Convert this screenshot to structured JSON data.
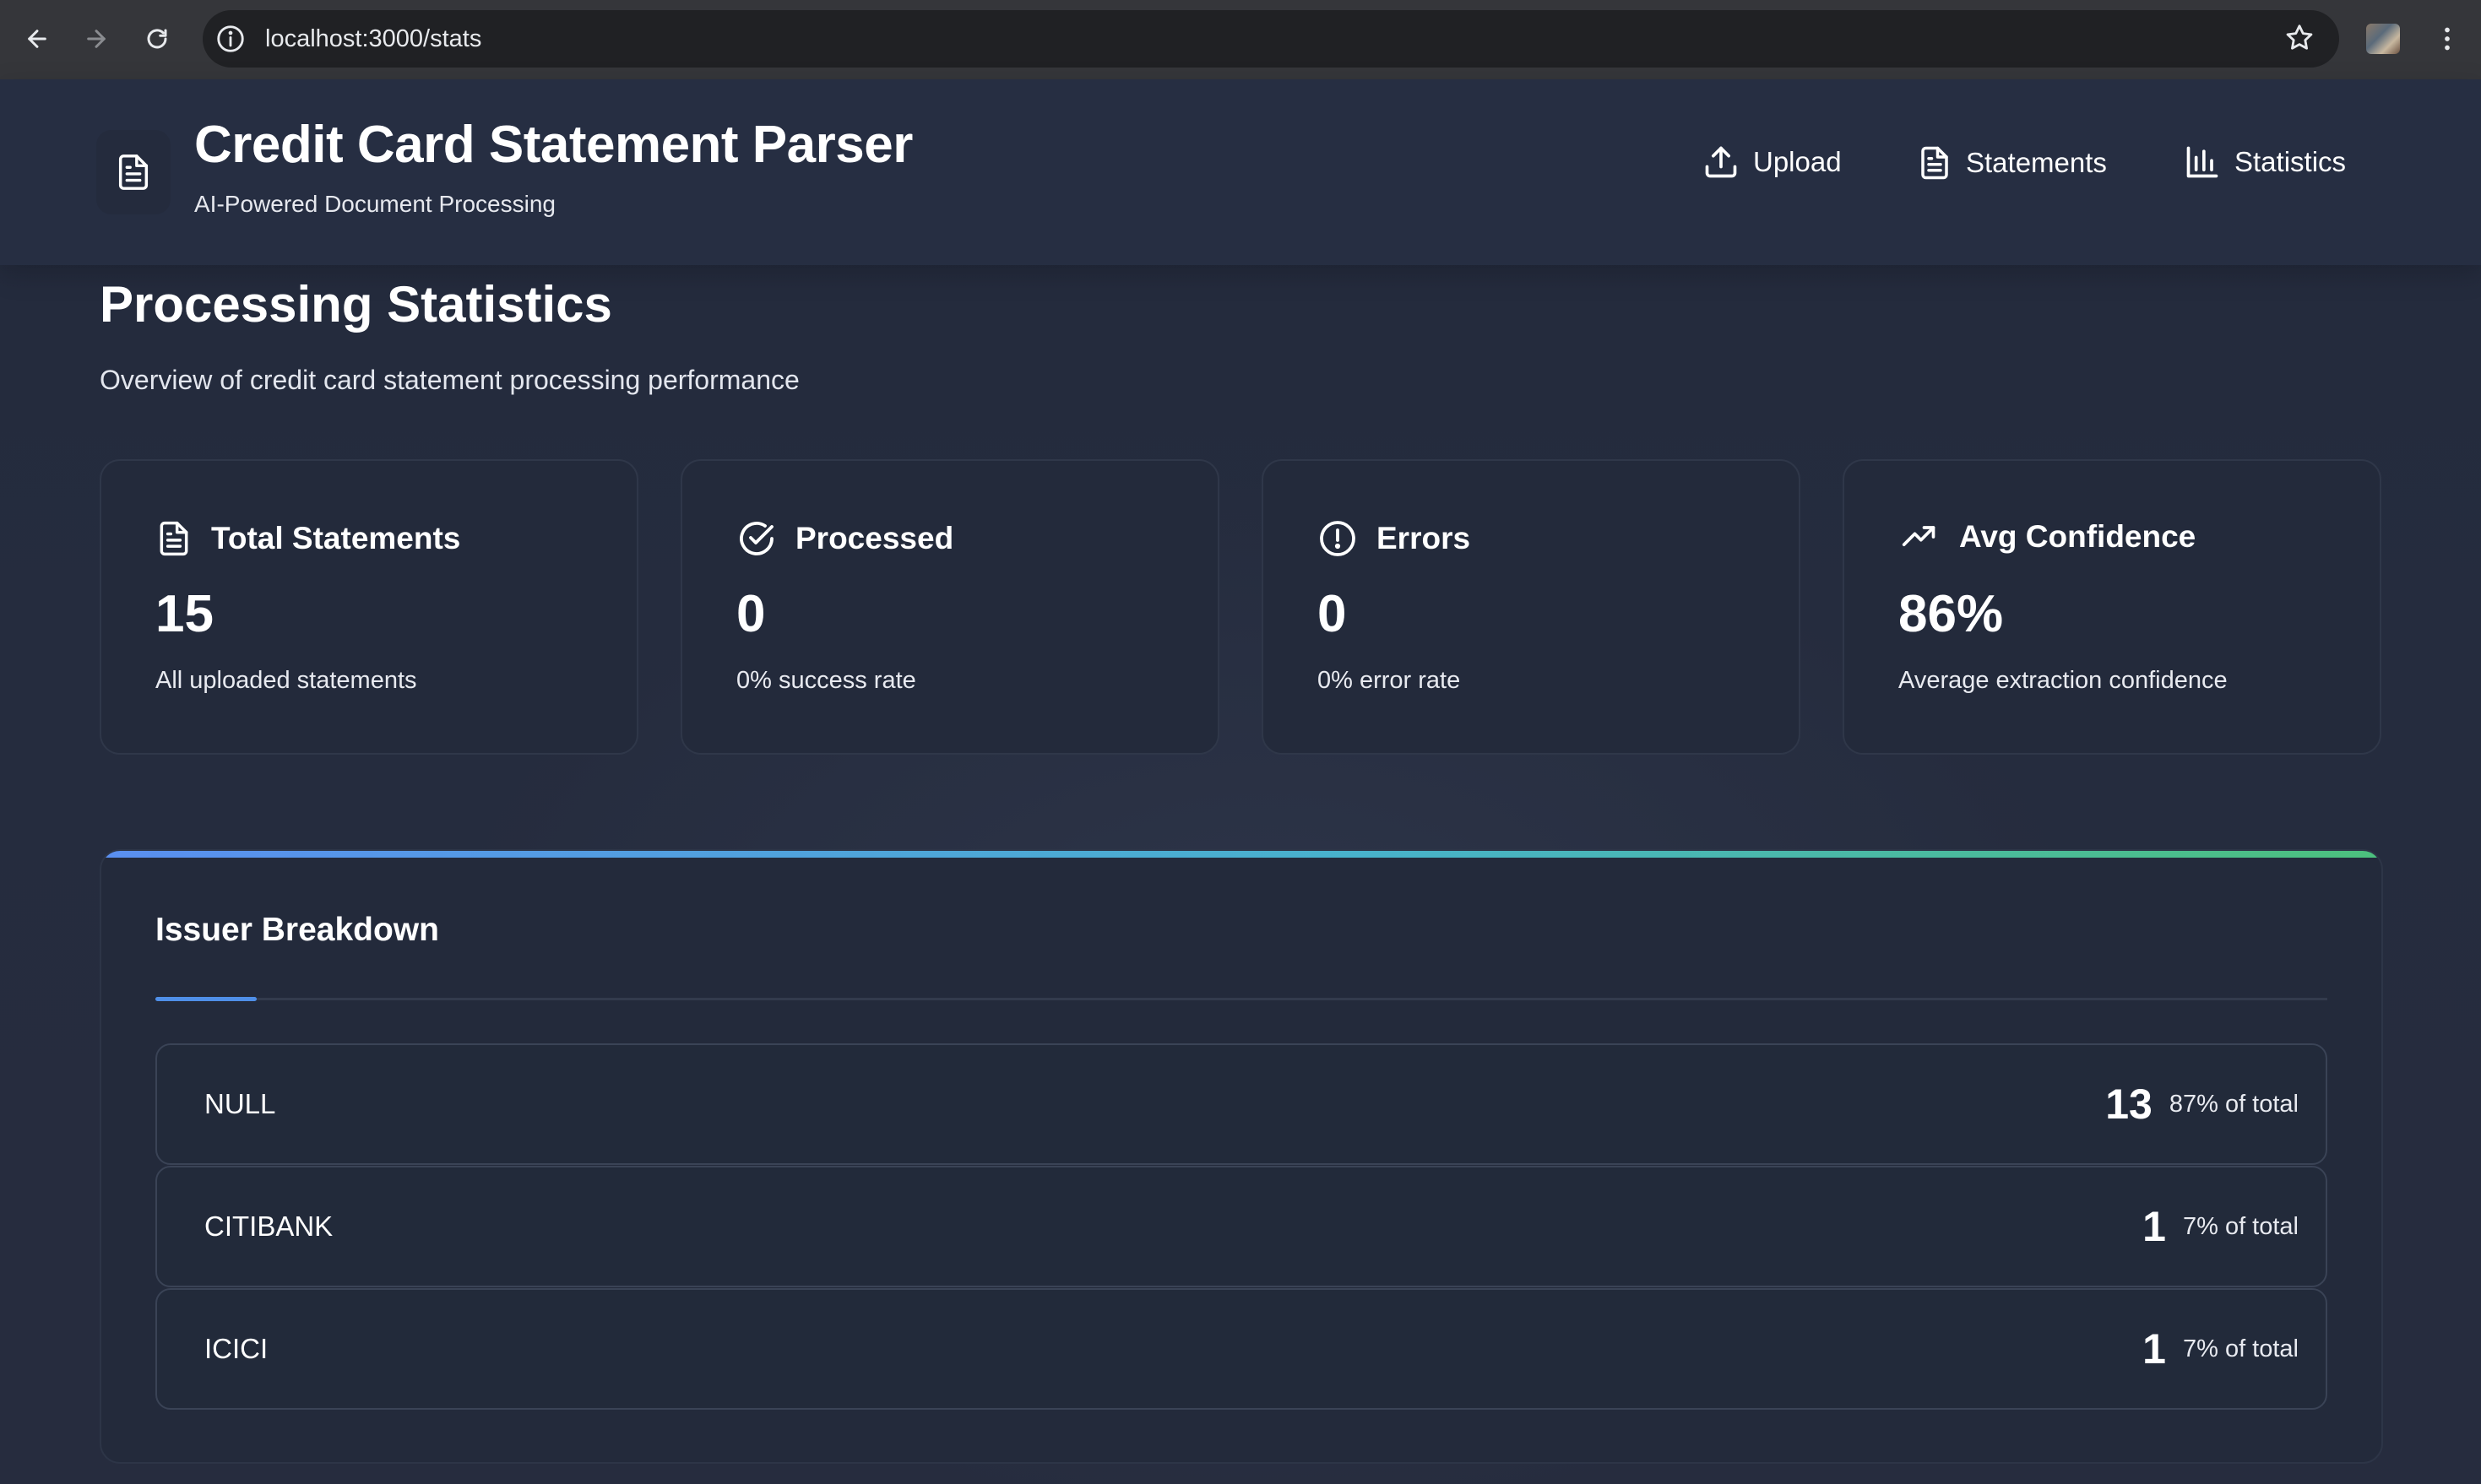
{
  "browser": {
    "url": "localhost:3000/stats"
  },
  "header": {
    "title": "Credit Card Statement Parser",
    "subtitle": "AI-Powered Document Processing",
    "nav": [
      {
        "label": "Upload",
        "icon": "upload-icon"
      },
      {
        "label": "Statements",
        "icon": "document-icon"
      },
      {
        "label": "Statistics",
        "icon": "bar-chart-icon"
      }
    ]
  },
  "main": {
    "title": "Processing Statistics",
    "subtitle": "Overview of credit card statement processing performance",
    "cards": [
      {
        "label": "Total Statements",
        "value": "15",
        "description": "All uploaded statements",
        "icon": "document-icon"
      },
      {
        "label": "Processed",
        "value": "0",
        "description": "0% success rate",
        "icon": "check-circle-icon"
      },
      {
        "label": "Errors",
        "value": "0",
        "description": "0% error rate",
        "icon": "alert-circle-icon"
      },
      {
        "label": "Avg Confidence",
        "value": "86%",
        "description": "Average extraction confidence",
        "icon": "trending-up-icon"
      }
    ],
    "breakdown": {
      "title": "Issuer Breakdown",
      "rows": [
        {
          "name": "NULL",
          "count": "13",
          "percent": "87% of total"
        },
        {
          "name": "CITIBANK",
          "count": "1",
          "percent": "7% of total"
        },
        {
          "name": "ICICI",
          "count": "1",
          "percent": "7% of total"
        }
      ]
    }
  },
  "colors": {
    "background": "#1f2535",
    "card": "#232a3b",
    "accent_blue": "#5a8ff0",
    "accent_green": "#4cc07d"
  }
}
